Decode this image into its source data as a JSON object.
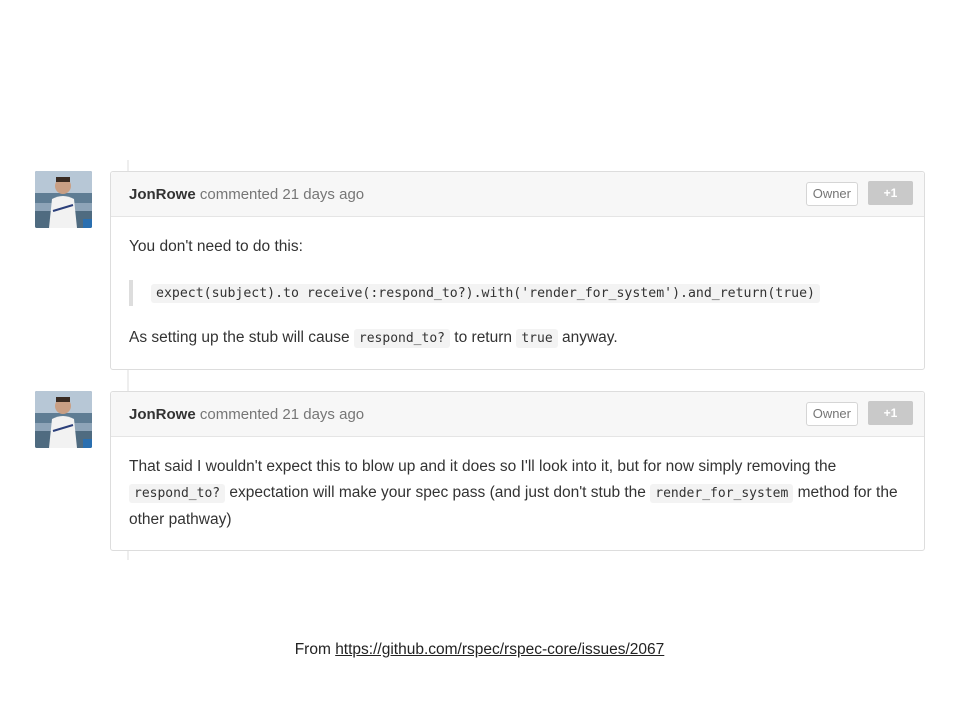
{
  "comments": [
    {
      "author": "JonRowe",
      "meta": "commented 21 days ago",
      "owner_label": "Owner",
      "reaction_label": "+1",
      "text_1": "You don't need to do this:",
      "quote_code": "expect(subject).to receive(:respond_to?).with('render_for_system').and_return(true)",
      "text_2a": "As setting up the stub will cause",
      "code_a": "respond_to?",
      "text_2b": "to return",
      "code_b": "true",
      "text_2c": "anyway."
    },
    {
      "author": "JonRowe",
      "meta": "commented 21 days ago",
      "owner_label": "Owner",
      "reaction_label": "+1",
      "text_a": "That said I wouldn't expect this to blow up and it does so I'll look into it, but for now simply removing the",
      "code_a": "respond_to?",
      "text_b": "expectation will make your spec pass (and just don't stub the",
      "code_b": "render_for_system",
      "text_c": "method for the other pathway)"
    }
  ],
  "footer": {
    "prefix": "From",
    "link_text": "https://github.com/rspec/rspec-core/issues/2067"
  }
}
